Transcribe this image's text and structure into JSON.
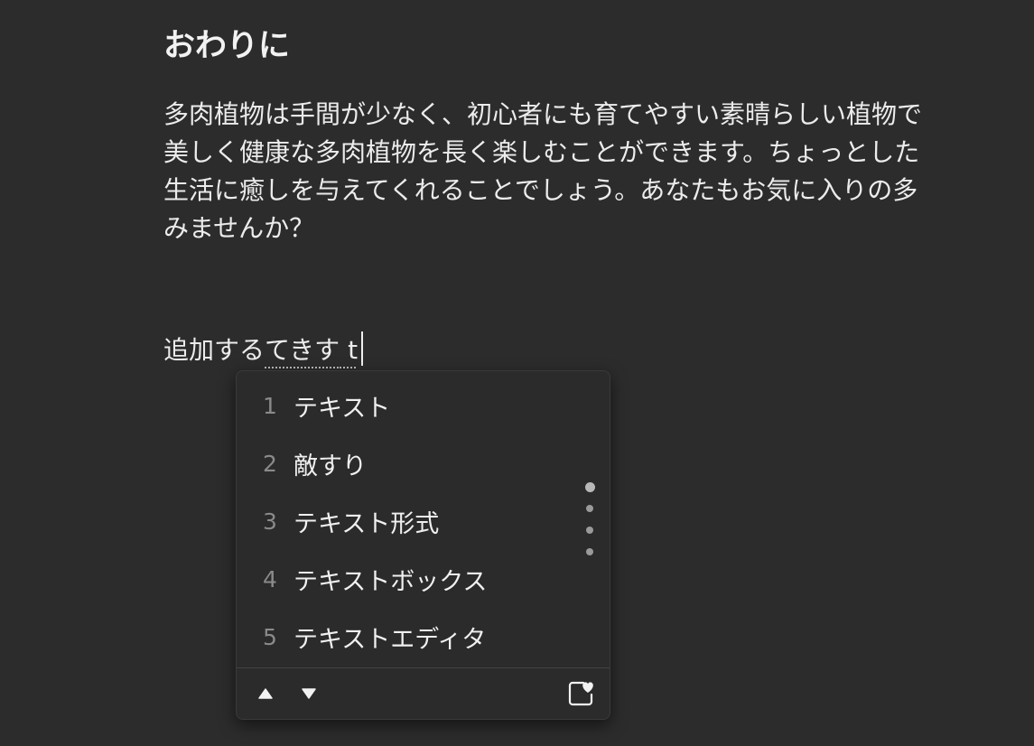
{
  "document": {
    "heading": "おわりに",
    "paragraph_lines": [
      "多肉植物は手間が少なく、初心者にも育てやすい素晴らしい植物で",
      "美しく健康な多肉植物を長く楽しむことができます。ちょっとした",
      "生活に癒しを与えてくれることでしょう。あなたもお気に入りの多",
      "みませんか？"
    ],
    "input_line": {
      "committed": "追加する",
      "composing": "てきす",
      "raw": " t"
    }
  },
  "ime": {
    "candidates": [
      {
        "num": "1",
        "text": "テキスト"
      },
      {
        "num": "2",
        "text": "敵すり"
      },
      {
        "num": "3",
        "text": "テキスト形式"
      },
      {
        "num": "4",
        "text": "テキストボックス"
      },
      {
        "num": "5",
        "text": "テキストエディタ"
      }
    ],
    "page_indicator": {
      "total": 4,
      "active": 1
    },
    "footer_icons": [
      "triangle-up-icon",
      "triangle-down-icon",
      "favorite-heart-icon"
    ]
  },
  "colors": {
    "background": "#2c2c2c",
    "popup_background": "#2b2b2b",
    "text": "#ececec",
    "candidate_number": "#8a8a8a"
  }
}
